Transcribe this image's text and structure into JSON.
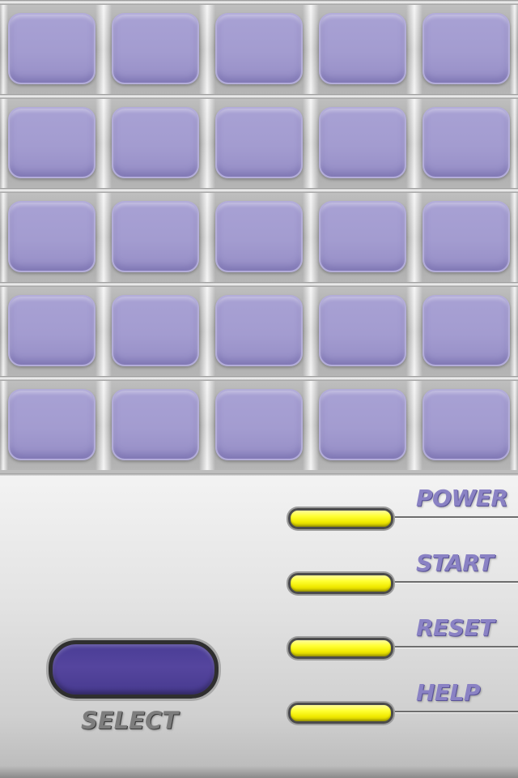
{
  "board": {
    "rows": 5,
    "columns": 5,
    "tile_color": "#a39cd0"
  },
  "controls": {
    "buttons": [
      {
        "label": "POWER"
      },
      {
        "label": "START"
      },
      {
        "label": "RESET"
      },
      {
        "label": "HELP"
      }
    ],
    "button_color": "#ffff33",
    "label_color": "#8a82c4"
  },
  "select": {
    "label": "SELECT",
    "button_color": "#55459e"
  }
}
